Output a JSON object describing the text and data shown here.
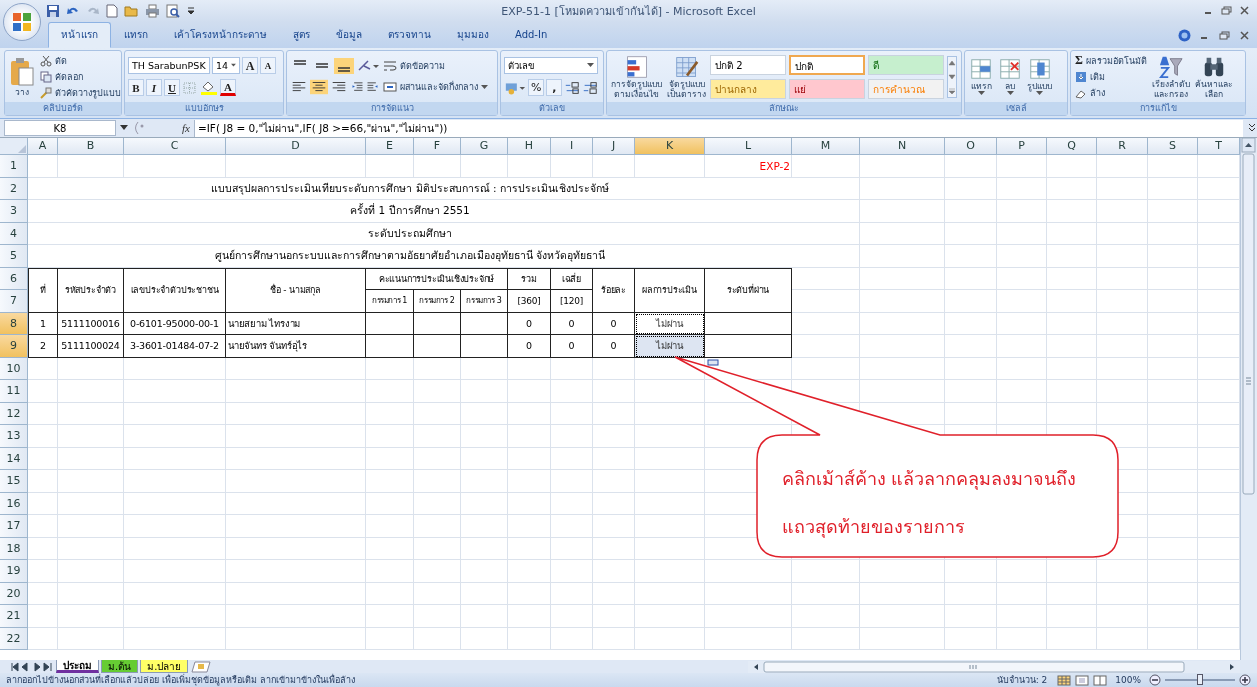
{
  "window": {
    "title": "EXP-51-1  [โหมดความเข้ากันได้] - Microsoft Excel"
  },
  "ribbon": {
    "tabs": [
      {
        "label": "หน้าแรก",
        "selected": true
      },
      {
        "label": "แทรก",
        "selected": false
      },
      {
        "label": "เค้าโครงหน้ากระดาษ",
        "selected": false
      },
      {
        "label": "สูตร",
        "selected": false
      },
      {
        "label": "ข้อมูล",
        "selected": false
      },
      {
        "label": "ตรวจทาน",
        "selected": false
      },
      {
        "label": "มุมมอง",
        "selected": false
      },
      {
        "label": "Add-In",
        "selected": false
      }
    ],
    "groups": [
      {
        "kind": "clipboard",
        "title": "คลิปบอร์ด",
        "paste": "วาง",
        "items": [
          "ตัด",
          "คัดลอก",
          "ตัวคัดวางรูปแบบ"
        ]
      },
      {
        "kind": "font",
        "title": "แบบอักษร",
        "font_name": "TH SarabunPSK",
        "font_size": "14",
        "grow": "A",
        "shrink": "A",
        "bold": "B",
        "italic": "I",
        "underline": "U",
        "font_color": "A"
      },
      {
        "kind": "alignment",
        "title": "การจัดแนว",
        "vertical": [
          {
            "selected": false
          },
          {
            "selected": false
          },
          {
            "selected": true
          }
        ],
        "horizontal": [
          {
            "selected": false
          },
          {
            "selected": true
          },
          {
            "selected": false
          }
        ],
        "wrap": "ตัดข้อความ",
        "merge": "ผสานและจัดกึ่งกลาง"
      },
      {
        "kind": "number",
        "title": "ตัวเลข",
        "format": "ตัวเลข",
        "percent": "%",
        "comma": ","
      },
      {
        "kind": "styles",
        "title": "ลักษณะ",
        "conditional": [
          "การจัดรูปแบบ",
          "ตามเงื่อนไข"
        ],
        "as_table": [
          "จัดรูปแบบ",
          "เป็นตาราง"
        ],
        "cell_styles": [
          {
            "label": "ปกติ 2",
            "kind": "normal",
            "color": "#ffffff",
            "selected": false
          },
          {
            "label": "ปกติ",
            "kind": "normal",
            "color": "#ffffff",
            "selected": true
          },
          {
            "label": "ดี",
            "kind": "good",
            "color": "#c6efce",
            "selected": false
          },
          {
            "label": "ปานกลาง",
            "kind": "neutral",
            "color": "#ffeb9c",
            "selected": false
          },
          {
            "label": "แย่",
            "kind": "bad",
            "color": "#ffc7ce",
            "selected": false
          },
          {
            "label": "การคำนวณ",
            "kind": "calculation",
            "color": "#f2f2f2",
            "selected": false
          }
        ]
      },
      {
        "kind": "cells",
        "title": "เซลล์",
        "buttons": [
          "แทรก",
          "ลบ",
          "รูปแบบ"
        ]
      },
      {
        "kind": "editing",
        "title": "การแก้ไข",
        "autosum_icon": "Σ",
        "autosum": "ผลรวมอัตโนมัติ",
        "fill": "เติม",
        "clear": "ล้าง",
        "sort": [
          "เรียงลำดับ",
          "และกรอง"
        ],
        "find": [
          "ค้นหาและ",
          "เลือก"
        ]
      }
    ]
  },
  "formula_bar": {
    "name_box": "K8",
    "fx_label": "fx",
    "formula": "=IF( J8 = 0,\"ไม่ผ่าน\",IF( J8 >=66,\"ผ่าน\",\"ไม่ผ่าน\"))"
  },
  "sheet": {
    "columns": [
      {
        "label": "A",
        "selected": false
      },
      {
        "label": "B",
        "selected": false
      },
      {
        "label": "C",
        "selected": false
      },
      {
        "label": "D",
        "selected": false
      },
      {
        "label": "E",
        "selected": false
      },
      {
        "label": "F",
        "selected": false
      },
      {
        "label": "G",
        "selected": false
      },
      {
        "label": "H",
        "selected": false
      },
      {
        "label": "I",
        "selected": false
      },
      {
        "label": "J",
        "selected": false
      },
      {
        "label": "K",
        "selected": true
      },
      {
        "label": "L",
        "selected": false
      },
      {
        "label": "M",
        "selected": false
      },
      {
        "label": "N",
        "selected": false
      },
      {
        "label": "O",
        "selected": false
      },
      {
        "label": "P",
        "selected": false
      },
      {
        "label": "Q",
        "selected": false
      },
      {
        "label": "R",
        "selected": false
      },
      {
        "label": "S",
        "selected": false
      },
      {
        "label": "T",
        "selected": false
      }
    ],
    "rows": [
      {
        "label": "1",
        "selected": false
      },
      {
        "label": "2",
        "selected": false
      },
      {
        "label": "3",
        "selected": false
      },
      {
        "label": "4",
        "selected": false
      },
      {
        "label": "5",
        "selected": false
      },
      {
        "label": "6",
        "selected": false
      },
      {
        "label": "7",
        "selected": false
      },
      {
        "label": "8",
        "selected": true
      },
      {
        "label": "9",
        "selected": true
      },
      {
        "label": "10",
        "selected": false
      },
      {
        "label": "11",
        "selected": false
      },
      {
        "label": "12",
        "selected": false
      },
      {
        "label": "13",
        "selected": false
      },
      {
        "label": "14",
        "selected": false
      },
      {
        "label": "15",
        "selected": false
      },
      {
        "label": "16",
        "selected": false
      },
      {
        "label": "17",
        "selected": false
      },
      {
        "label": "18",
        "selected": false
      },
      {
        "label": "19",
        "selected": false
      },
      {
        "label": "20",
        "selected": false
      },
      {
        "label": "21",
        "selected": false
      },
      {
        "label": "22",
        "selected": false
      }
    ],
    "tag": "EXP-2",
    "titles": [
      "แบบสรุปผลการประเมินเทียบระดับการศึกษา มิติประสบการณ์ : การประเมินเชิงประจักษ์",
      "ครั้งที่ 1 ปีการศึกษา 2551",
      "ระดับประถมศึกษา",
      "ศูนย์การศึกษานอกระบบและการศึกษาตามอัธยาศัยอำเภอเมืองอุทัยธานี จังหวัดอุทัยธานี"
    ],
    "table": {
      "header": [
        {
          "label": "ที่"
        },
        {
          "label": "รหัสประจำตัว"
        },
        {
          "label": "เลขประจำตัวประชาชน"
        },
        {
          "label": "ชื่อ - นามสกุล"
        },
        {
          "label": "คะแนนการประเมินเชิงประจักษ์",
          "subs": [
            "กรรมการ 1",
            "กรรมการ 2",
            "กรรมการ 3"
          ]
        },
        {
          "label": "รวม",
          "unit": "[360]"
        },
        {
          "label": "เฉลี่ย",
          "unit": "[120]"
        },
        {
          "label": "ร้อยละ"
        },
        {
          "label": "ผลการประเมิน"
        },
        {
          "label": "ระดับที่ผ่าน"
        }
      ],
      "rows": [
        {
          "no": "1",
          "student_id": "5111100016",
          "citizen_id": "0-6101-95000-00-1",
          "name": "นายสยาม  ไทรงาม",
          "total": "0",
          "average": "0",
          "percent": "0",
          "result": "ไม่ผ่าน",
          "selected": true,
          "active": true
        },
        {
          "no": "2",
          "student_id": "5111100024",
          "citizen_id": "3-3601-01484-07-2",
          "name": "นายจันทร  จันทร์อุไร",
          "total": "0",
          "average": "0",
          "percent": "0",
          "result": "ไม่ผ่าน",
          "selected": true,
          "active": false
        }
      ]
    }
  },
  "callout": {
    "lines": [
      "คลิกเม้าส์ค้าง แล้วลากคลุมลงมาจนถึง",
      "แถวสุดท้ายของรายการ"
    ]
  },
  "sheet_tabs": [
    {
      "label": "ประถม",
      "color": "#7030a0",
      "selected": true
    },
    {
      "label": "ม.ต้น",
      "color": "#66cc33",
      "selected": false
    },
    {
      "label": "ม.ปลาย",
      "color": "#ffff66",
      "selected": false
    }
  ],
  "status_bar": {
    "message": "ลากออกไปข้างนอกส่วนที่เลือกแล้วปล่อย เพื่อเพิ่มชุดข้อมูลหรือเติม ลากเข้ามาข้างในเพื่อล้าง",
    "count": "นับจำนวน: 2",
    "zoom": "100%",
    "zoom_slider": {
      "level": 0.5
    }
  }
}
